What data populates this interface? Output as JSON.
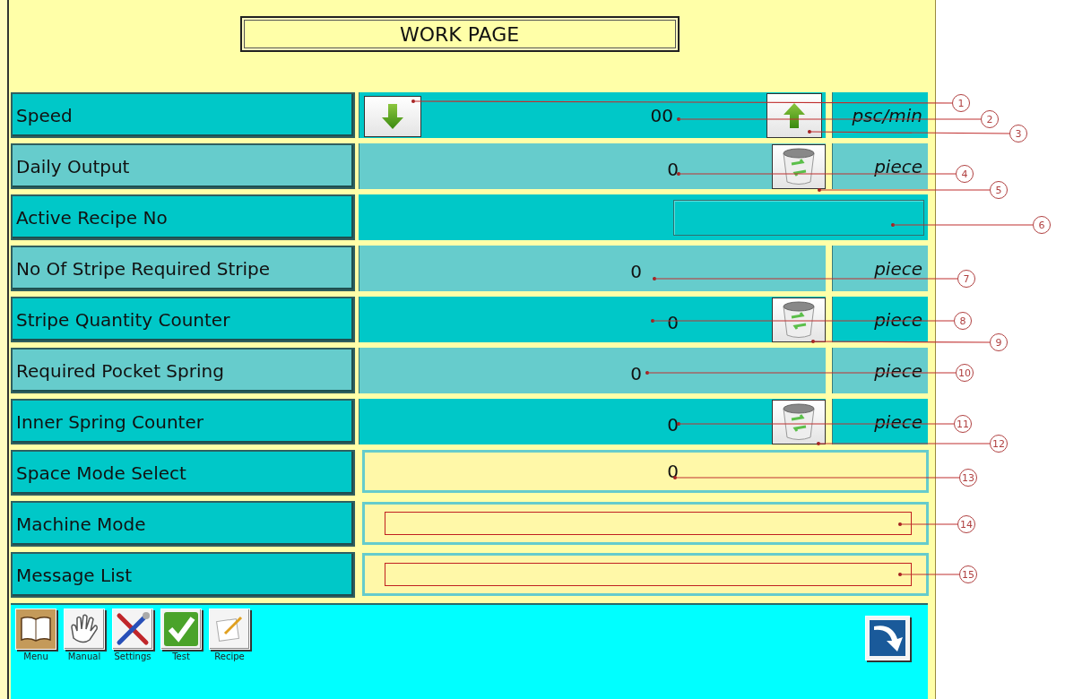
{
  "title": "WORK PAGE",
  "rows": [
    {
      "kind": "speed",
      "label": "Speed",
      "value": "00",
      "unit": "psc/min",
      "color": "#00c8c8"
    },
    {
      "kind": "reset",
      "label": "Daily Output",
      "value": "0",
      "unit": "piece",
      "color": "#66cccc"
    },
    {
      "kind": "recipe",
      "label": "Active Recipe No",
      "color": "#00c8c8"
    },
    {
      "kind": "readout",
      "label": "No Of Stripe Required Stripe",
      "value": "0",
      "unit": "piece",
      "color": "#66cccc"
    },
    {
      "kind": "reset",
      "label": "Stripe Quantity Counter",
      "value": "0",
      "unit": "piece",
      "color": "#00c8c8"
    },
    {
      "kind": "readout",
      "label": "Required Pocket Spring",
      "value": "0",
      "unit": "piece",
      "color": "#66cccc"
    },
    {
      "kind": "reset",
      "label": "Inner Spring Counter",
      "value": "0",
      "unit": "piece",
      "color": "#00c8c8"
    },
    {
      "kind": "mode",
      "label": "Space Mode Select",
      "value": "0",
      "color": "#00c8c8"
    },
    {
      "kind": "message",
      "label": "Machine Mode",
      "color": "#00c8c8"
    },
    {
      "kind": "message",
      "label": "Message List",
      "color": "#00c8c8"
    }
  ],
  "toolbar": [
    {
      "kind": "book",
      "label": "Menu"
    },
    {
      "kind": "hand",
      "label": "Manual"
    },
    {
      "kind": "tools",
      "label": "Settings"
    },
    {
      "kind": "check",
      "label": "Test"
    },
    {
      "kind": "notepad",
      "label": "Recipe"
    }
  ],
  "callouts": [
    {
      "number": "1"
    },
    {
      "number": "2"
    },
    {
      "number": "3"
    },
    {
      "number": "4"
    },
    {
      "number": "5"
    },
    {
      "number": "6"
    },
    {
      "number": "7"
    },
    {
      "number": "8"
    },
    {
      "number": "9"
    },
    {
      "number": "10"
    },
    {
      "number": "11"
    },
    {
      "number": "12"
    },
    {
      "number": "13"
    },
    {
      "number": "14"
    },
    {
      "number": "15"
    }
  ]
}
